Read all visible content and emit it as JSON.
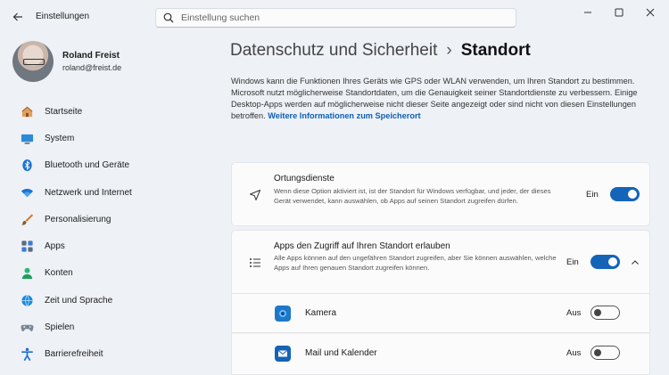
{
  "app": {
    "title": "Einstellungen",
    "search_placeholder": "Einstellung suchen"
  },
  "profile": {
    "name": "Roland Freist",
    "email": "roland@freist.de"
  },
  "sidebar": {
    "items": [
      {
        "label": "Startseite",
        "icon": "home-icon"
      },
      {
        "label": "System",
        "icon": "monitor-icon"
      },
      {
        "label": "Bluetooth und Geräte",
        "icon": "bluetooth-icon"
      },
      {
        "label": "Netzwerk und Internet",
        "icon": "wifi-icon"
      },
      {
        "label": "Personalisierung",
        "icon": "brush-icon"
      },
      {
        "label": "Apps",
        "icon": "apps-icon"
      },
      {
        "label": "Konten",
        "icon": "user-icon"
      },
      {
        "label": "Zeit und Sprache",
        "icon": "globe-clock-icon"
      },
      {
        "label": "Spielen",
        "icon": "gamepad-icon"
      },
      {
        "label": "Barrierefreiheit",
        "icon": "accessibility-icon"
      }
    ]
  },
  "header": {
    "parent": "Datenschutz und Sicherheit",
    "separator": "›",
    "current": "Standort"
  },
  "description": {
    "text": "Windows kann die Funktionen Ihres Geräts wie GPS oder WLAN verwenden, um Ihren Standort zu bestimmen. Microsoft nutzt möglicherweise Standortdaten, um die Genauigkeit seiner Standortdienste zu verbessern. Einige Desktop-Apps werden auf möglicherweise nicht dieser Seite angezeigt oder sind nicht von diesen Einstellungen betroffen.",
    "link": "Weitere Informationen zum Speicherort"
  },
  "location_services": {
    "title": "Ortungsdienste",
    "description": "Wenn diese Option aktiviert ist, ist der Standort für Windows verfügbar, und jeder, der dieses Gerät verwendet, kann auswählen, ob Apps auf seinen Standort zugreifen dürfen.",
    "state": "Ein",
    "enabled": true
  },
  "app_access": {
    "title": "Apps den Zugriff auf Ihren Standort erlauben",
    "description": "Alle Apps können auf den ungefähren Standort zugreifen, aber Sie können auswählen, welche Apps auf Ihren genauen Standort zugreifen können.",
    "state": "Ein",
    "enabled": true,
    "expanded": true
  },
  "apps": [
    {
      "name": "Kamera",
      "state": "Aus",
      "enabled": false,
      "icon": "camera-app-icon",
      "color": "#1e78c8"
    },
    {
      "name": "Mail und Kalender",
      "state": "Aus",
      "enabled": false,
      "icon": "mail-app-icon",
      "color": "#1463b5"
    }
  ],
  "colors": {
    "accent": "#1464b8",
    "link": "#0e5fb5"
  }
}
